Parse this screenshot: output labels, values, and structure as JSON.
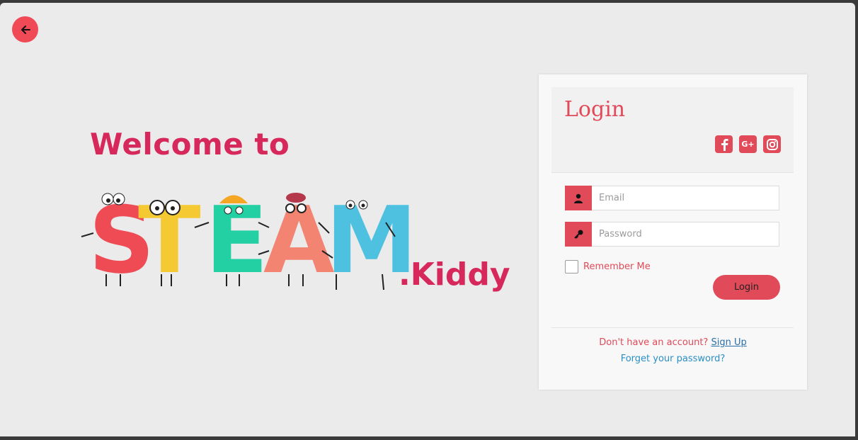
{
  "nav": {
    "back_icon": "arrow-left-icon"
  },
  "hero": {
    "welcome": "Welcome to",
    "brand_letters": [
      "S",
      "T",
      "E",
      "A",
      "M"
    ],
    "brand_suffix": ".Kiddy"
  },
  "login": {
    "title": "Login",
    "social": [
      {
        "icon": "facebook-icon"
      },
      {
        "icon": "google-plus-icon",
        "glyph": "G+"
      },
      {
        "icon": "instagram-icon"
      }
    ],
    "email_placeholder": "Email",
    "email_value": "",
    "password_placeholder": "Password",
    "password_value": "",
    "remember_label": "Remember Me",
    "submit_label": "Login",
    "no_account_text": "Don't have an account?",
    "signup_label": "Sign Up",
    "forgot_label": "Forget your password?"
  },
  "colors": {
    "accent": "#e14a59",
    "brand_title": "#d6285a",
    "letter_S": "#ef4b55",
    "letter_T": "#f5c932",
    "letter_E": "#22d0a4",
    "letter_A": "#f38472",
    "letter_M": "#4fc1e0",
    "link": "#2a8fc5"
  }
}
